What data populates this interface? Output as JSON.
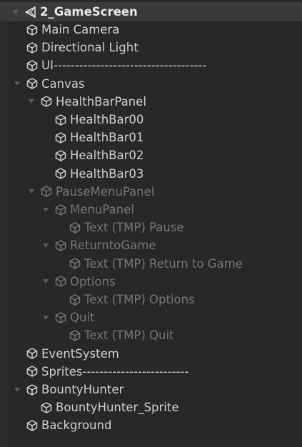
{
  "scene": {
    "name": "2_GameScreen"
  },
  "items": [
    {
      "label": "Main Camera",
      "depth": 1,
      "expanded": false,
      "has_children": false,
      "disabled": false
    },
    {
      "label": "Directional Light",
      "depth": 1,
      "expanded": false,
      "has_children": false,
      "disabled": false
    },
    {
      "label": "UI------------------------------------",
      "depth": 1,
      "expanded": false,
      "has_children": false,
      "disabled": false
    },
    {
      "label": "Canvas",
      "depth": 1,
      "expanded": true,
      "has_children": true,
      "disabled": false
    },
    {
      "label": "HealthBarPanel",
      "depth": 2,
      "expanded": true,
      "has_children": true,
      "disabled": false
    },
    {
      "label": "HealthBar00",
      "depth": 3,
      "expanded": false,
      "has_children": false,
      "disabled": false
    },
    {
      "label": "HealthBar01",
      "depth": 3,
      "expanded": false,
      "has_children": false,
      "disabled": false
    },
    {
      "label": "HealthBar02",
      "depth": 3,
      "expanded": false,
      "has_children": false,
      "disabled": false
    },
    {
      "label": "HealthBar03",
      "depth": 3,
      "expanded": false,
      "has_children": false,
      "disabled": false
    },
    {
      "label": "PauseMenuPanel",
      "depth": 2,
      "expanded": true,
      "has_children": true,
      "disabled": true
    },
    {
      "label": "MenuPanel",
      "depth": 3,
      "expanded": true,
      "has_children": true,
      "disabled": true
    },
    {
      "label": "Text (TMP) Pause",
      "depth": 4,
      "expanded": false,
      "has_children": false,
      "disabled": true
    },
    {
      "label": "ReturntoGame",
      "depth": 3,
      "expanded": true,
      "has_children": true,
      "disabled": true
    },
    {
      "label": "Text (TMP) Return to Game",
      "depth": 4,
      "expanded": false,
      "has_children": false,
      "disabled": true
    },
    {
      "label": "Options",
      "depth": 3,
      "expanded": true,
      "has_children": true,
      "disabled": true
    },
    {
      "label": "Text (TMP) Options",
      "depth": 4,
      "expanded": false,
      "has_children": false,
      "disabled": true
    },
    {
      "label": "Quit",
      "depth": 3,
      "expanded": true,
      "has_children": true,
      "disabled": true
    },
    {
      "label": "Text (TMP) Quit",
      "depth": 4,
      "expanded": false,
      "has_children": false,
      "disabled": true
    },
    {
      "label": "EventSystem",
      "depth": 1,
      "expanded": false,
      "has_children": false,
      "disabled": false
    },
    {
      "label": "Sprites-------------------------",
      "depth": 1,
      "expanded": false,
      "has_children": false,
      "disabled": false
    },
    {
      "label": "BountyHunter",
      "depth": 1,
      "expanded": true,
      "has_children": true,
      "disabled": false
    },
    {
      "label": "BountyHunter_Sprite",
      "depth": 2,
      "expanded": false,
      "has_children": false,
      "disabled": false
    },
    {
      "label": "Background",
      "depth": 1,
      "expanded": false,
      "has_children": false,
      "disabled": false
    }
  ],
  "icons": {
    "scene": "unity-scene-icon",
    "object": "gameobject-cube-icon",
    "arrow": "expand-arrow-icon"
  },
  "colors": {
    "background": "#282828",
    "scene_row": "#3a3a3a",
    "text": "#d0d0d0",
    "disabled_text": "#767676"
  }
}
